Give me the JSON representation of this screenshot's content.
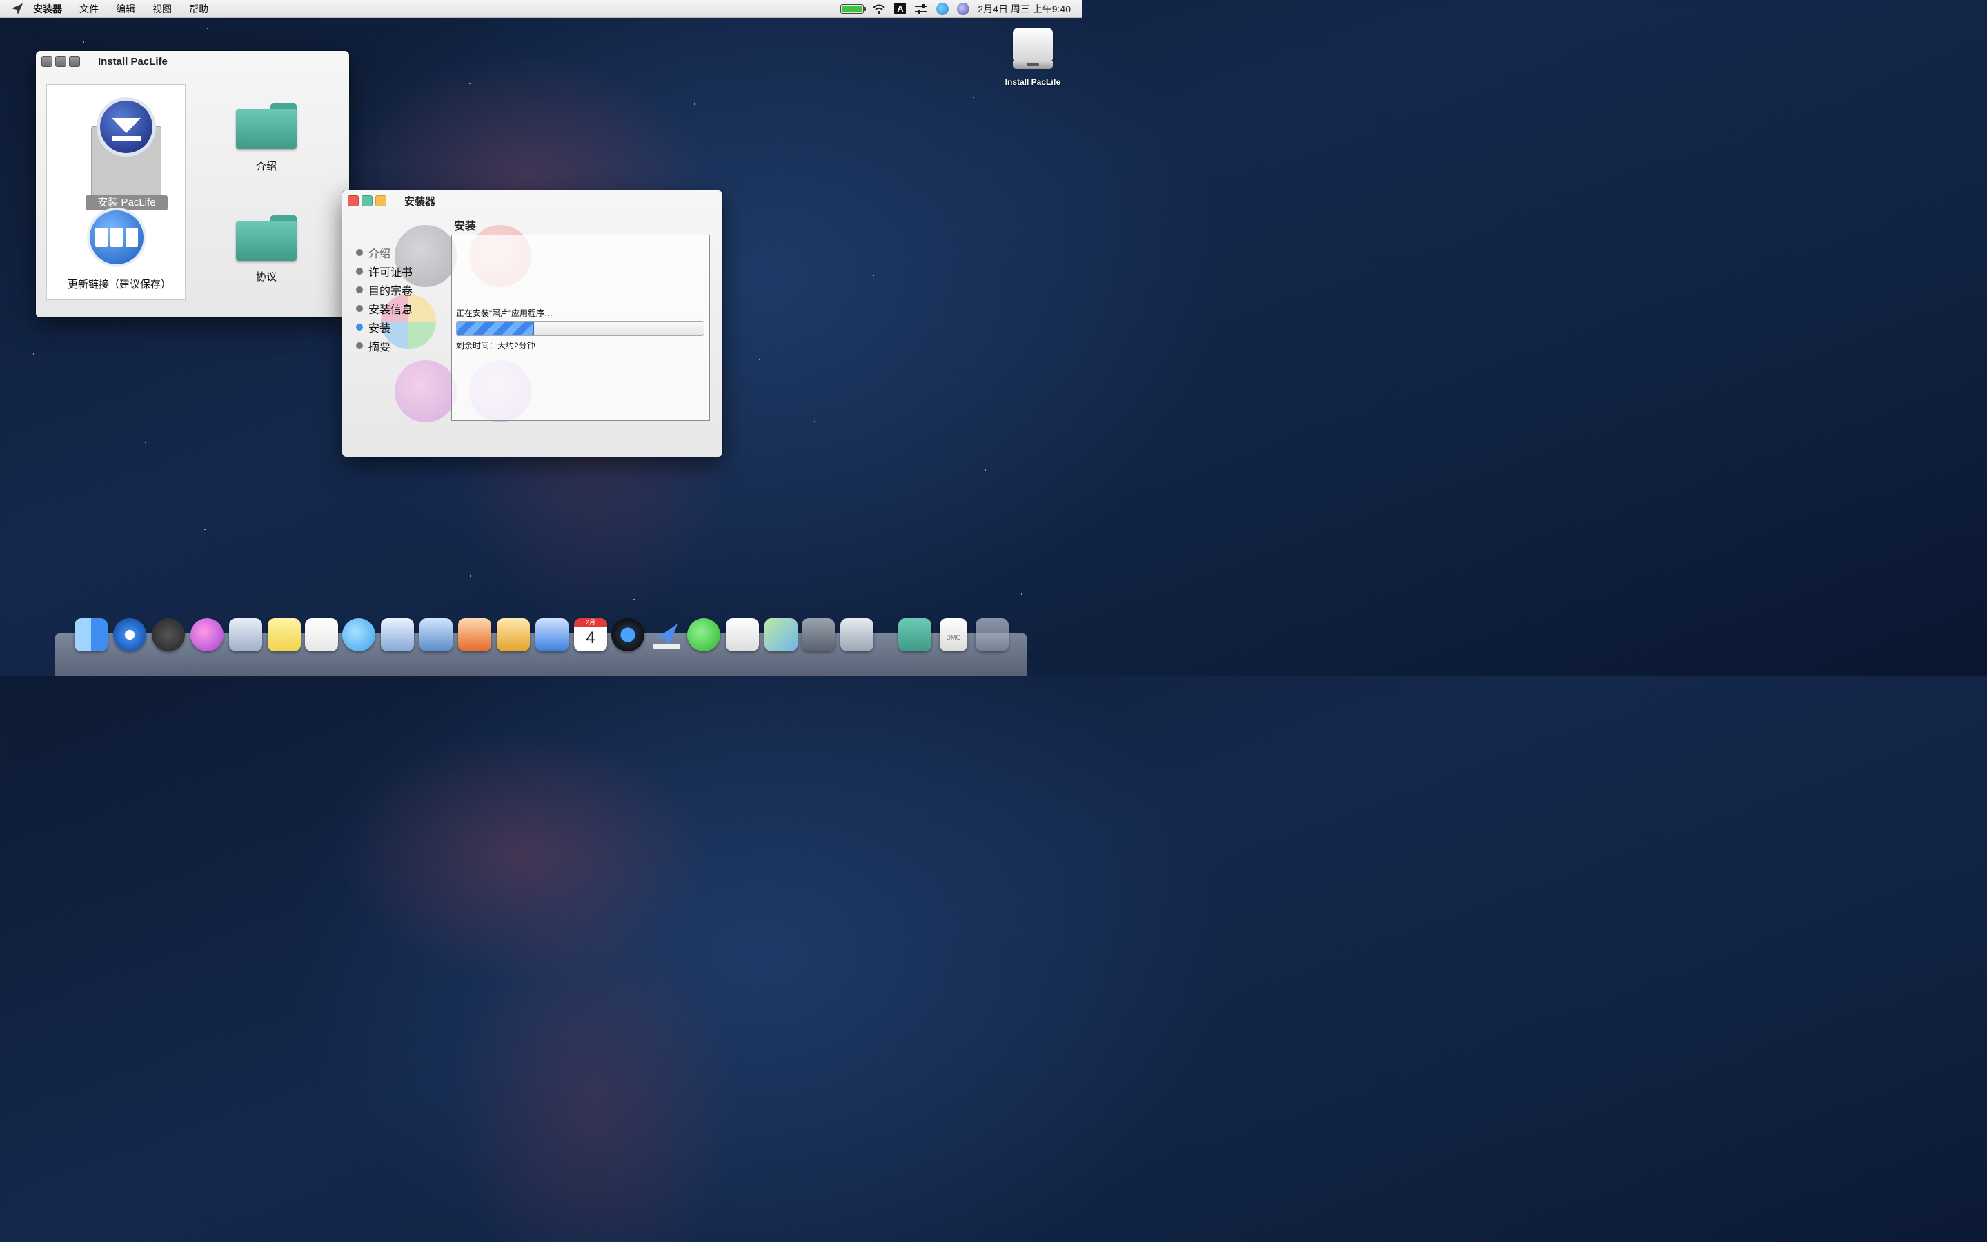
{
  "menubar": {
    "app": "安装器",
    "items": [
      "文件",
      "编辑",
      "视图",
      "帮助"
    ],
    "clock": "2月4日 周三 上午9:40",
    "input_method": "A"
  },
  "desktop": {
    "disk_label": "Install PacLife"
  },
  "finder_window": {
    "title": "Install PacLife",
    "items": {
      "install": "安装 PacLife",
      "intro": "介绍",
      "update": "更新链接（建议保存）",
      "agreement": "协议"
    }
  },
  "installer_window": {
    "title": "安装器",
    "section_title": "安装",
    "steps": [
      "介绍",
      "许可证书",
      "目的宗卷",
      "安装信息",
      "安装",
      "摘要"
    ],
    "active_step": 4,
    "status": "正在安装“照片”应用程序…",
    "progress": 0.31,
    "remaining": "剩余时间：大约2分钟"
  },
  "colors": {
    "accent": "#3a8df2",
    "folder": "#5bb8a4",
    "close": "#ee5e55",
    "minimize": "#f4bf4f",
    "zoom": "#60c3a6"
  },
  "dock": {
    "icons": [
      "finder-icon",
      "safari-icon",
      "launchpad-icon",
      "itunes-icon",
      "mail-icon",
      "notes-icon",
      "reminders-icon",
      "messages-icon",
      "contacts-icon",
      "preview-icon",
      "pages-icon",
      "keynote-icon",
      "numbers-icon",
      "calendar-icon",
      "time-machine-icon",
      "paperclip-icon",
      "wechat-icon",
      "textedit-icon",
      "maps-icon",
      "utility-icon",
      "downloads-icon",
      "folder-icon",
      "dmg-icon",
      "trash-icon"
    ],
    "calendar_month": "2月",
    "calendar_day": "4",
    "dmg_label": "DMG"
  }
}
